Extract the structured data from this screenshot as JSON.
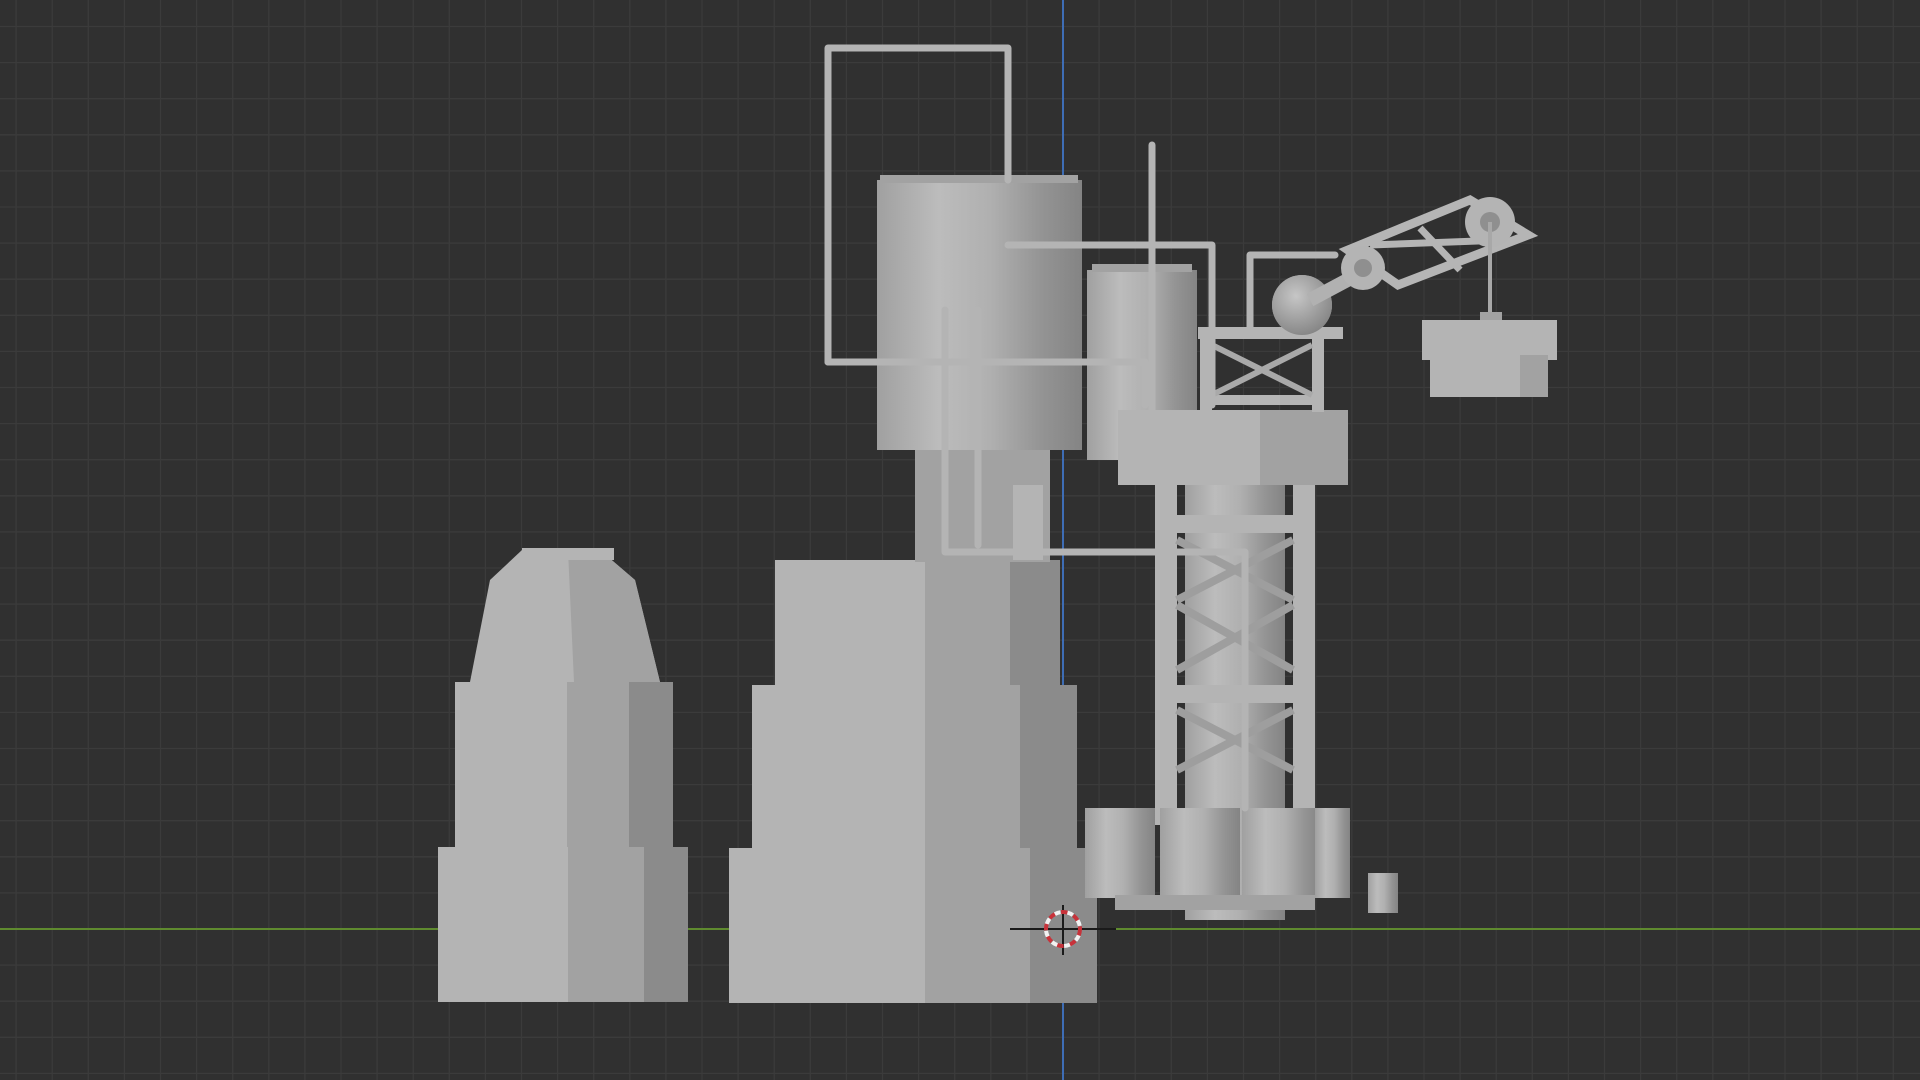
{
  "app": {
    "view": "3d-viewport",
    "projection": "front-orthographic",
    "shading": "solid"
  },
  "colors": {
    "background": "#303030",
    "grid_minor": "#3b3b3b",
    "grid_major": "#424242",
    "axis_x": "#5f8a2f",
    "axis_z": "#3e6db5",
    "mesh_light": "#b4b4b4",
    "mesh_mid": "#a2a2a2",
    "mesh_dark": "#8b8b8b",
    "cursor_red": "#c8323a",
    "cursor_white": "#f2f2f2"
  },
  "scene": {
    "objects": [
      "left-bottle-kiln",
      "central-kiln-base",
      "tall-cylinder-tank",
      "secondary-cylinder-tank",
      "lattice-support-tower",
      "pipe-network",
      "crane-arm",
      "hanging-crate",
      "barrel-cluster",
      "small-canister"
    ],
    "cursor": "3d-cursor"
  }
}
